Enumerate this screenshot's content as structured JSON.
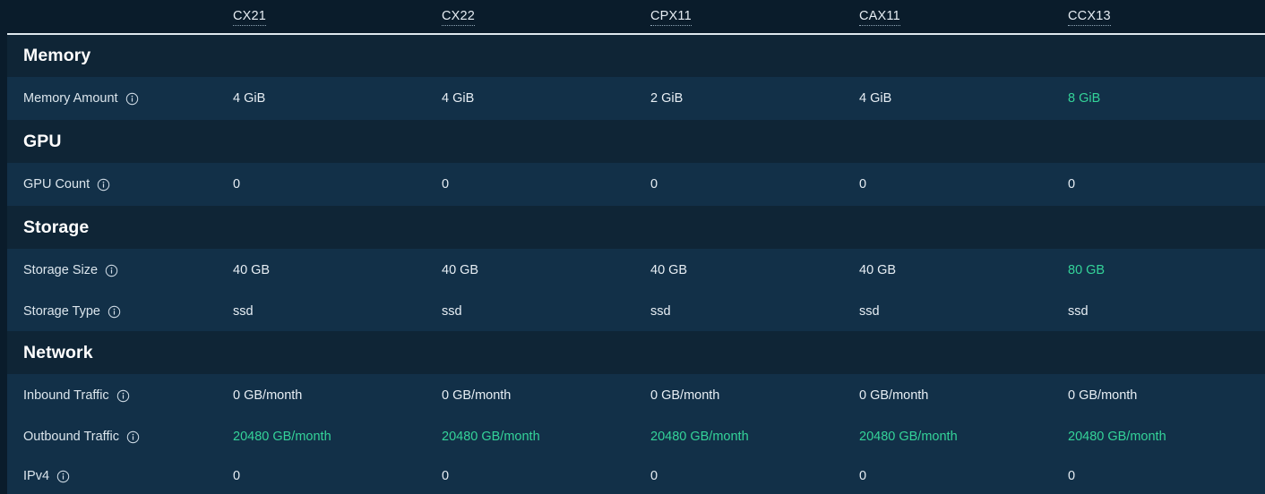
{
  "theme": {
    "page_bg": "#0a1c2b",
    "section_bg": "#0f2536",
    "row_bg": "#123048",
    "text": "#e7eef4",
    "muted_text": "#dbe5ec",
    "highlight": "#34d399",
    "divider": "#dfe8ee"
  },
  "table": {
    "row_label_header": "",
    "columns": [
      {
        "name": "CX21"
      },
      {
        "name": "CX22"
      },
      {
        "name": "CPX11"
      },
      {
        "name": "CAX11"
      },
      {
        "name": "CCX13"
      }
    ],
    "sections": [
      {
        "title": "Memory",
        "rows": [
          {
            "label": "Memory Amount",
            "info_icon": "info-icon",
            "values": [
              {
                "text": "4 GiB",
                "best": false
              },
              {
                "text": "4 GiB",
                "best": false
              },
              {
                "text": "2 GiB",
                "best": false
              },
              {
                "text": "4 GiB",
                "best": false
              },
              {
                "text": "8 GiB",
                "best": true
              }
            ]
          }
        ]
      },
      {
        "title": "GPU",
        "rows": [
          {
            "label": "GPU Count",
            "info_icon": "info-icon",
            "values": [
              {
                "text": "0",
                "best": false
              },
              {
                "text": "0",
                "best": false
              },
              {
                "text": "0",
                "best": false
              },
              {
                "text": "0",
                "best": false
              },
              {
                "text": "0",
                "best": false
              }
            ]
          }
        ]
      },
      {
        "title": "Storage",
        "rows": [
          {
            "label": "Storage Size",
            "info_icon": "info-icon",
            "values": [
              {
                "text": "40 GB",
                "best": false
              },
              {
                "text": "40 GB",
                "best": false
              },
              {
                "text": "40 GB",
                "best": false
              },
              {
                "text": "40 GB",
                "best": false
              },
              {
                "text": "80 GB",
                "best": true
              }
            ]
          },
          {
            "label": "Storage Type",
            "info_icon": "info-icon",
            "values": [
              {
                "text": "ssd",
                "best": false
              },
              {
                "text": "ssd",
                "best": false
              },
              {
                "text": "ssd",
                "best": false
              },
              {
                "text": "ssd",
                "best": false
              },
              {
                "text": "ssd",
                "best": false
              }
            ]
          }
        ]
      },
      {
        "title": "Network",
        "rows": [
          {
            "label": "Inbound Traffic",
            "info_icon": "info-icon",
            "values": [
              {
                "text": "0 GB/month",
                "best": false
              },
              {
                "text": "0 GB/month",
                "best": false
              },
              {
                "text": "0 GB/month",
                "best": false
              },
              {
                "text": "0 GB/month",
                "best": false
              },
              {
                "text": "0 GB/month",
                "best": false
              }
            ]
          },
          {
            "label": "Outbound Traffic",
            "info_icon": "info-icon",
            "values": [
              {
                "text": "20480 GB/month",
                "best": true
              },
              {
                "text": "20480 GB/month",
                "best": true
              },
              {
                "text": "20480 GB/month",
                "best": true
              },
              {
                "text": "20480 GB/month",
                "best": true
              },
              {
                "text": "20480 GB/month",
                "best": true
              }
            ]
          },
          {
            "label": "IPv4",
            "info_icon": "info-icon",
            "values": [
              {
                "text": "0",
                "best": false
              },
              {
                "text": "0",
                "best": false
              },
              {
                "text": "0",
                "best": false
              },
              {
                "text": "0",
                "best": false
              },
              {
                "text": "0",
                "best": false
              }
            ]
          }
        ]
      }
    ]
  }
}
